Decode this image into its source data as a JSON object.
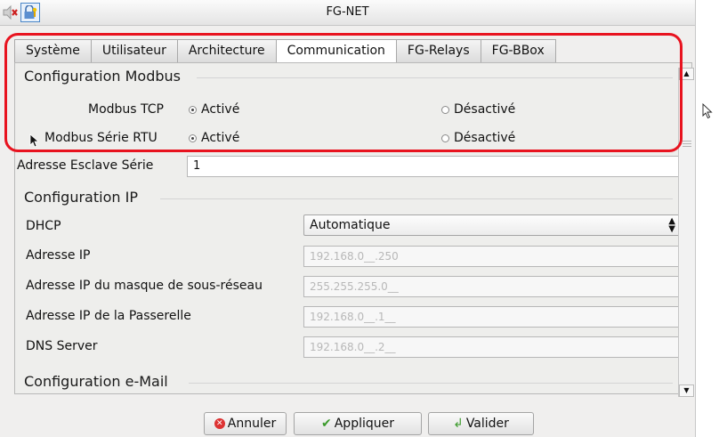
{
  "window": {
    "title": "FG-NET"
  },
  "titlebar_icons": [
    "speaker-muted-icon",
    "lock-key-icon"
  ],
  "tabs": [
    {
      "label": "Système",
      "active": false
    },
    {
      "label": "Utilisateur",
      "active": false
    },
    {
      "label": "Architecture",
      "active": false
    },
    {
      "label": "Communication",
      "active": true
    },
    {
      "label": "FG-Relays",
      "active": false
    },
    {
      "label": "FG-BBox",
      "active": false
    }
  ],
  "modbus": {
    "section_title": "Configuration Modbus",
    "tcp": {
      "label": "Modbus TCP",
      "on_label": "Activé",
      "off_label": "Désactivé",
      "selected": "on"
    },
    "rtu": {
      "label": "Modbus Série RTU",
      "on_label": "Activé",
      "off_label": "Désactivé",
      "selected": "on"
    },
    "slave_label": "Adresse Esclave Série",
    "slave_value": "1"
  },
  "ip": {
    "section_title": "Configuration IP",
    "dhcp_label": "DHCP",
    "dhcp_value": "Automatique",
    "ip_label": "Adresse IP",
    "ip_value": "192.168.0__.250",
    "mask_label": "Adresse IP du masque de sous-réseau",
    "mask_value": "255.255.255.0__",
    "gateway_label": "Adresse IP de la Passerelle",
    "gateway_value": "192.168.0__.1__",
    "dns_label": "DNS Server",
    "dns_value": "192.168.0__.2__"
  },
  "email": {
    "section_title": "Configuration e-Mail"
  },
  "buttons": {
    "cancel": "Annuler",
    "apply": "Appliquer",
    "validate": "Valider"
  },
  "colors": {
    "highlight": "#e8131f",
    "cancel_icon": "#dd3333",
    "ok_icon": "#3a9a2a"
  }
}
